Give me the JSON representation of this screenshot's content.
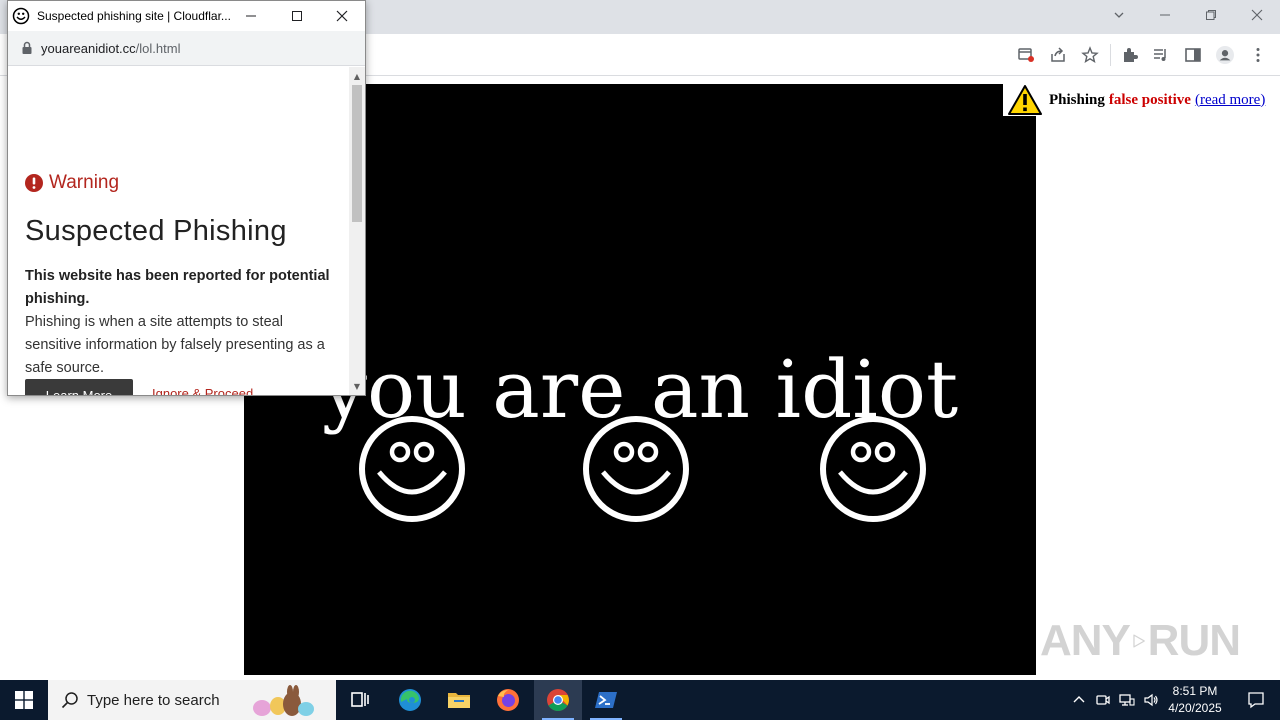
{
  "popup": {
    "title": "Suspected phishing site | Cloudflar...",
    "url_host": "youareanidiot.cc",
    "url_path": "/lol.html",
    "warning_label": "Warning",
    "heading": "Suspected Phishing",
    "reported_text": "This website has been reported for potential phishing.",
    "explanation": "Phishing is when a site attempts to steal sensitive information by falsely presenting as a safe source.",
    "learn_more_label": "Learn More",
    "ignore_label": "Ignore & Proceed",
    "scroll_position_fraction": 0.0
  },
  "page": {
    "main_text": "you are an idiot",
    "banner": {
      "phishing": "Phishing",
      "false_positive": "false positive",
      "read_more": "(read more)"
    },
    "colors": {
      "stage_bg": "#000000",
      "main_text": "#ffffff",
      "false_positive": "#cc0000",
      "link": "#0000cc"
    }
  },
  "browser_toolbar": {
    "icons": [
      "cast-icon",
      "share-icon",
      "bookmark-star-icon",
      "extensions-icon",
      "media-controls-icon",
      "side-panel-icon",
      "profile-icon",
      "kebab-menu-icon"
    ]
  },
  "watermark": {
    "left": "ANY",
    "right": "RUN"
  },
  "taskbar": {
    "search_placeholder": "Type here to search",
    "apps": [
      "task-view",
      "edge",
      "file-explorer",
      "firefox",
      "chrome",
      "powershell"
    ],
    "active_app": "chrome",
    "time": "8:51 PM",
    "date": "4/20/2025"
  }
}
